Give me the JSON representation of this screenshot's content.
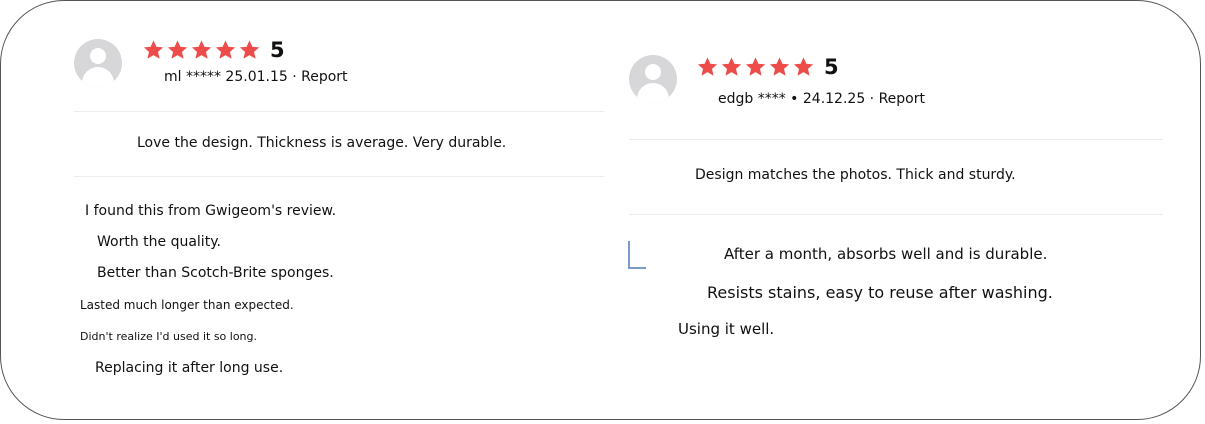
{
  "reviews": [
    {
      "rating": "5",
      "meta": "ml ***** 25.01.15 · Report",
      "summary": "Love the design. Thickness is average. Very durable.",
      "lines": [
        "I found this from Gwigeom's review.",
        "Worth the quality.",
        "Better than Scotch-Brite sponges.",
        "Lasted much longer than expected.",
        "Didn't realize I'd used it so long.",
        "Replacing it after long use."
      ]
    },
    {
      "rating": "5",
      "meta": "edgb **** • 24.12.25 · Report",
      "summary": "Design matches the photos. Thick and sturdy.",
      "lines": [
        "After a month, absorbs well and is durable.",
        "Resists stains, easy to reuse after washing.",
        "Using it well."
      ]
    }
  ],
  "colors": {
    "star": "#ee4b4b",
    "avatar": "#d7d7d9",
    "divider": "#ececec"
  },
  "icons": {
    "avatar": "user-avatar-icon",
    "star": "star-icon"
  }
}
